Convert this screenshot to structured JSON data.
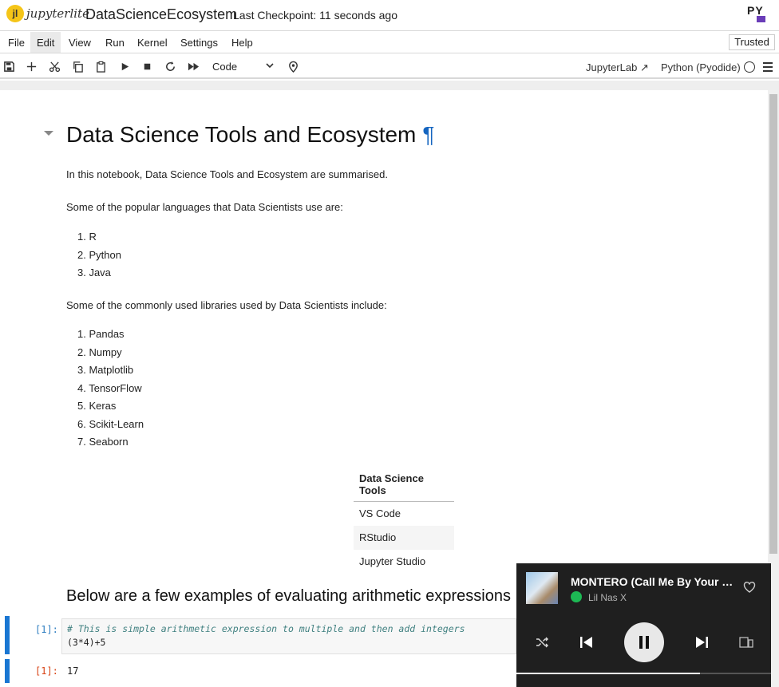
{
  "header": {
    "logo_text": "jupyterlite",
    "notebook_name": "DataScienceEcosystem",
    "checkpoint": "Last Checkpoint: 11 seconds ago",
    "py_logo": "PY"
  },
  "menu": {
    "items": [
      "File",
      "Edit",
      "View",
      "Run",
      "Kernel",
      "Settings",
      "Help"
    ],
    "active": "Edit",
    "trusted": "Trusted"
  },
  "toolbar": {
    "icons": [
      "save-icon",
      "add-icon",
      "cut-icon",
      "copy-icon",
      "paste-icon",
      "run-icon",
      "stop-icon",
      "restart-icon",
      "fast-forward-icon"
    ],
    "cell_type": "Code",
    "jupyterlab_link": "JupyterLab",
    "kernel": "Python (Pyodide)"
  },
  "notebook": {
    "title": "Data Science Tools and Ecosystem",
    "pilcrow": "¶",
    "intro": "In this notebook, Data Science Tools and Ecosystem are summarised.",
    "languages_intro": "Some of the popular languages that Data Scientists use are:",
    "languages": [
      "1. R",
      "2. Python",
      "3. Java"
    ],
    "libraries_intro": "Some of the commonly used libraries used by Data Scientists include:",
    "libraries": [
      "1. Pandas",
      "2. Numpy",
      "3. Matplotlib",
      "4. TensorFlow",
      "5. Keras",
      "6. Scikit-Learn",
      "7. Seaborn"
    ],
    "tools_table": {
      "header": "Data Science Tools",
      "rows": [
        "VS Code",
        "RStudio",
        "Jupyter Studio"
      ]
    },
    "arith_heading": "Below are a few examples of evaluating arithmetic expressions",
    "code_cell": {
      "in_prompt": "[1]:",
      "comment": "# This is simple arithmetic expression to multiple and then add integers",
      "code": "(3*4)+5",
      "out_prompt": "[1]:",
      "output": "17"
    }
  },
  "player": {
    "song": "MONTERO (Call Me By Your Name)",
    "artist": "Lil Nas X",
    "progress": 0.72,
    "colors": {
      "background": "#1f1f1f",
      "spotify_green": "#1db954"
    }
  }
}
